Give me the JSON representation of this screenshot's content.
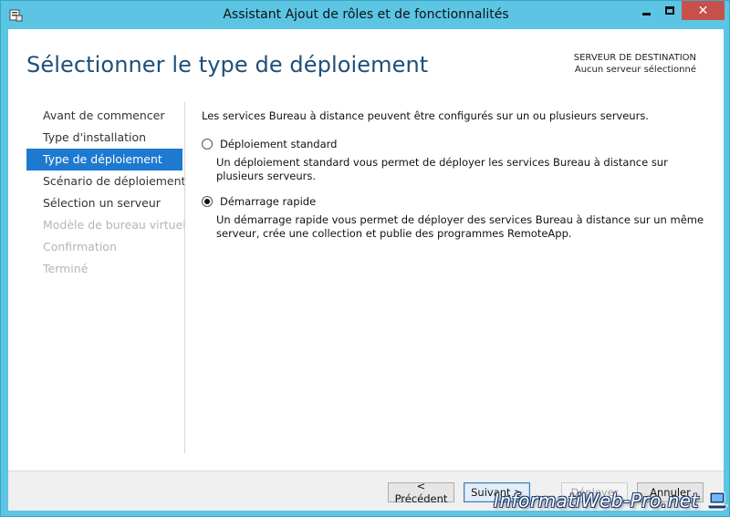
{
  "window": {
    "title": "Assistant Ajout de rôles et de fonctionnalités",
    "close_glyph": "✕"
  },
  "header": {
    "page_title": "Sélectionner le type de déploiement",
    "destination_label": "SERVEUR DE DESTINATION",
    "destination_value": "Aucun serveur sélectionné"
  },
  "nav": {
    "items": [
      {
        "label": "Avant de commencer",
        "state": "normal"
      },
      {
        "label": "Type d'installation",
        "state": "normal"
      },
      {
        "label": "Type de déploiement",
        "state": "active"
      },
      {
        "label": "Scénario de déploiement",
        "state": "normal"
      },
      {
        "label": "Sélection un serveur",
        "state": "normal"
      },
      {
        "label": "Modèle de bureau virtuel",
        "state": "disabled"
      },
      {
        "label": "Confirmation",
        "state": "disabled"
      },
      {
        "label": "Terminé",
        "state": "disabled"
      }
    ]
  },
  "content": {
    "intro": "Les services Bureau à distance peuvent être configurés sur un ou plusieurs serveurs.",
    "options": [
      {
        "label": "Déploiement standard",
        "checked": false,
        "description": "Un déploiement standard vous permet de déployer les services Bureau à distance sur plusieurs serveurs."
      },
      {
        "label": "Démarrage rapide",
        "checked": true,
        "description": "Un démarrage rapide vous permet de déployer des services Bureau à distance sur un même serveur, crée une collection et publie des programmes RemoteApp."
      }
    ]
  },
  "footer": {
    "previous_label": "< Précédent",
    "next_label": "Suivant >",
    "deploy_label": "Déployer",
    "cancel_label": "Annuler"
  },
  "watermark": {
    "text": "InformatiWeb-Pro.net"
  },
  "colors": {
    "accent": "#1e7ad0",
    "title_blue": "#1e4f7a",
    "window_frame": "#5bc5e3",
    "close_red": "#c7504a"
  }
}
